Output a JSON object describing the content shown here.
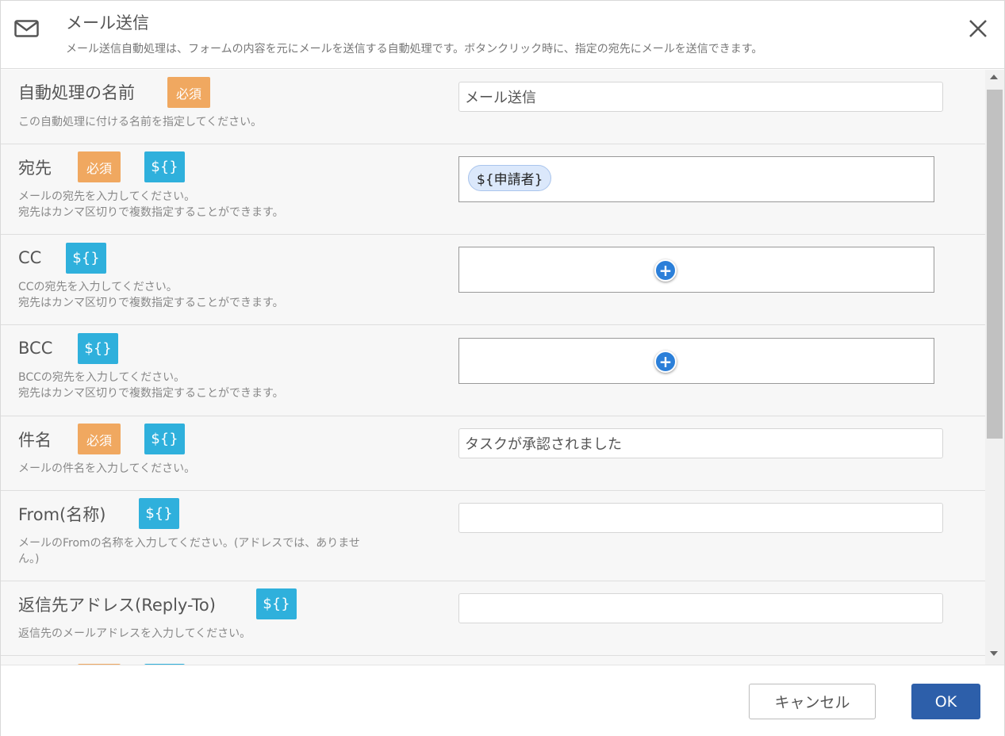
{
  "header": {
    "title": "メール送信",
    "description": "メール送信自動処理は、フォームの内容を元にメールを送信する自動処理です。ボタンクリック時に、指定の宛先にメールを送信できます。"
  },
  "badges": {
    "required": "必須",
    "variable": "${}"
  },
  "fields": {
    "name": {
      "label": "自動処理の名前",
      "hint": "この自動処理に付ける名前を指定してください。",
      "value": "メール送信"
    },
    "to": {
      "label": "宛先",
      "hint_line1": "メールの宛先を入力してください。",
      "hint_line2": "宛先はカンマ区切りで複数指定することができます。",
      "chip": "${申請者}"
    },
    "cc": {
      "label": "CC",
      "hint_line1": "CCの宛先を入力してください。",
      "hint_line2": "宛先はカンマ区切りで複数指定することができます。"
    },
    "bcc": {
      "label": "BCC",
      "hint_line1": "BCCの宛先を入力してください。",
      "hint_line2": "宛先はカンマ区切りで複数指定することができます。"
    },
    "subject": {
      "label": "件名",
      "hint": "メールの件名を入力してください。",
      "value": "タスクが承認されました"
    },
    "from_name": {
      "label": "From(名称)",
      "hint_line1": "メールのFromの名称を入力してください。(アドレスでは、ありませ",
      "hint_line2": "ん。)",
      "value": ""
    },
    "reply_to": {
      "label": "返信先アドレス(Reply-To)",
      "hint": "返信先のメールアドレスを入力してください。",
      "value": ""
    }
  },
  "footer": {
    "cancel_label": "キャンセル",
    "ok_label": "OK"
  },
  "icons": {
    "header": "mail-icon",
    "close": "close-icon",
    "add": "plus-circle-icon"
  },
  "colors": {
    "required_badge": "#f0a860",
    "variable_badge": "#2fb0dc",
    "ok_button": "#2d5faa",
    "add_button": "#2b7fd9"
  }
}
